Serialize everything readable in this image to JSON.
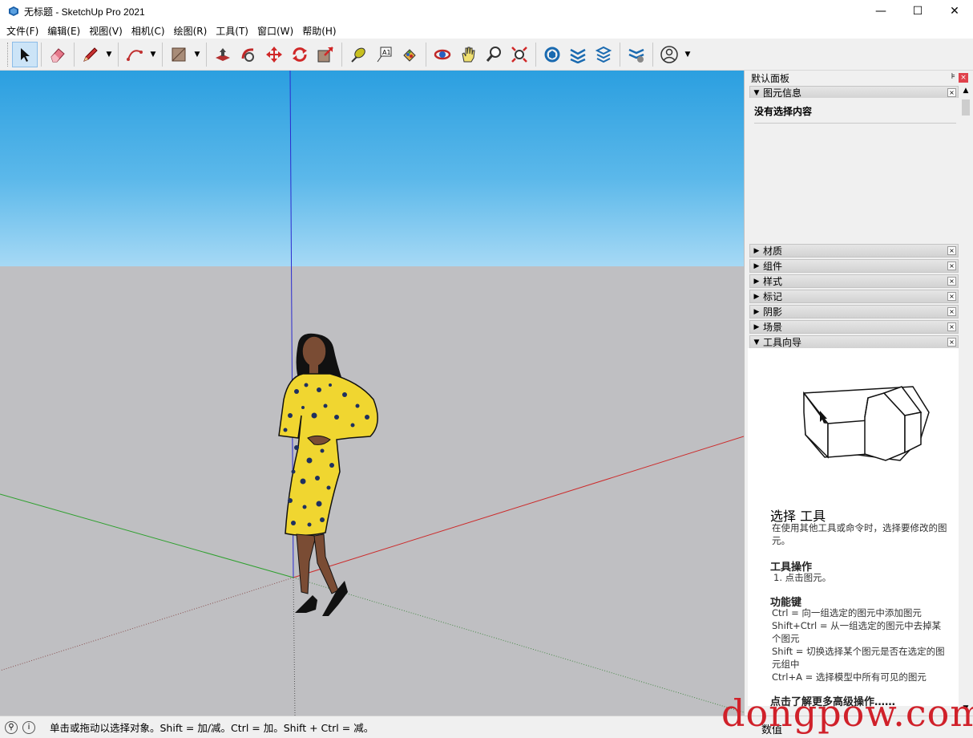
{
  "window": {
    "title": "无标题 - SketchUp Pro 2021",
    "minimize": "—",
    "maximize": "☐",
    "close": "✕"
  },
  "menu": [
    "文件(F)",
    "编辑(E)",
    "视图(V)",
    "相机(C)",
    "绘图(R)",
    "工具(T)",
    "窗口(W)",
    "帮助(H)"
  ],
  "toolbar": {
    "tools": [
      "select-icon",
      "eraser-icon",
      "pencil-icon",
      "arc-icon",
      "rectangle-icon",
      "push-pull-icon",
      "follow-me-icon",
      "move-icon",
      "rotate-icon",
      "scale-icon",
      "tape-measure-icon",
      "text-icon",
      "paint-bucket-icon",
      "orbit-icon",
      "pan-icon",
      "zoom-icon",
      "zoom-extents-icon",
      "warehouse-icon",
      "extension-icon",
      "layout-icon",
      "sandbox-icon",
      "account-icon"
    ],
    "active_tool": "select-icon"
  },
  "tray": {
    "title": "默认面板",
    "pin": "⊧",
    "close": "×",
    "entity_info": {
      "label": "图元信息",
      "no_selection": "没有选择内容"
    },
    "collapsed_panels": [
      "材质",
      "组件",
      "样式",
      "标记",
      "阴影",
      "场景"
    ],
    "instructor": {
      "label": "工具向导",
      "tool_title": "选择 工具",
      "tool_desc": "在使用其他工具或命令时，选择要修改的图元。",
      "ops_title": "工具操作",
      "ops_item": "1. 点击图元。",
      "keys_title": "功能键",
      "key_ctrl": "Ctrl = 向一组选定的图元中添加图元",
      "key_shift_ctrl": "Shift+Ctrl = 从一组选定的图元中去掉某个图元",
      "key_shift": "Shift = 切换选择某个图元是否在选定的图元组中",
      "key_ctrl_a": "Ctrl+A = 选择模型中所有可见的图元",
      "more_link": "点击了解更多高级操作……"
    }
  },
  "status": {
    "hint": "单击或拖动以选择对象。Shift = 加/减。Ctrl = 加。Shift + Ctrl = 减。",
    "value_label": "数值",
    "value": ""
  },
  "watermark": "dongpow.com",
  "colors": {
    "sky_top": "#2b9fe0",
    "ground": "#bfbfc2",
    "axis_red": "#cc2b2b",
    "axis_green": "#2ea02e",
    "axis_blue": "#2a2ad0",
    "watermark": "#d0212a"
  }
}
